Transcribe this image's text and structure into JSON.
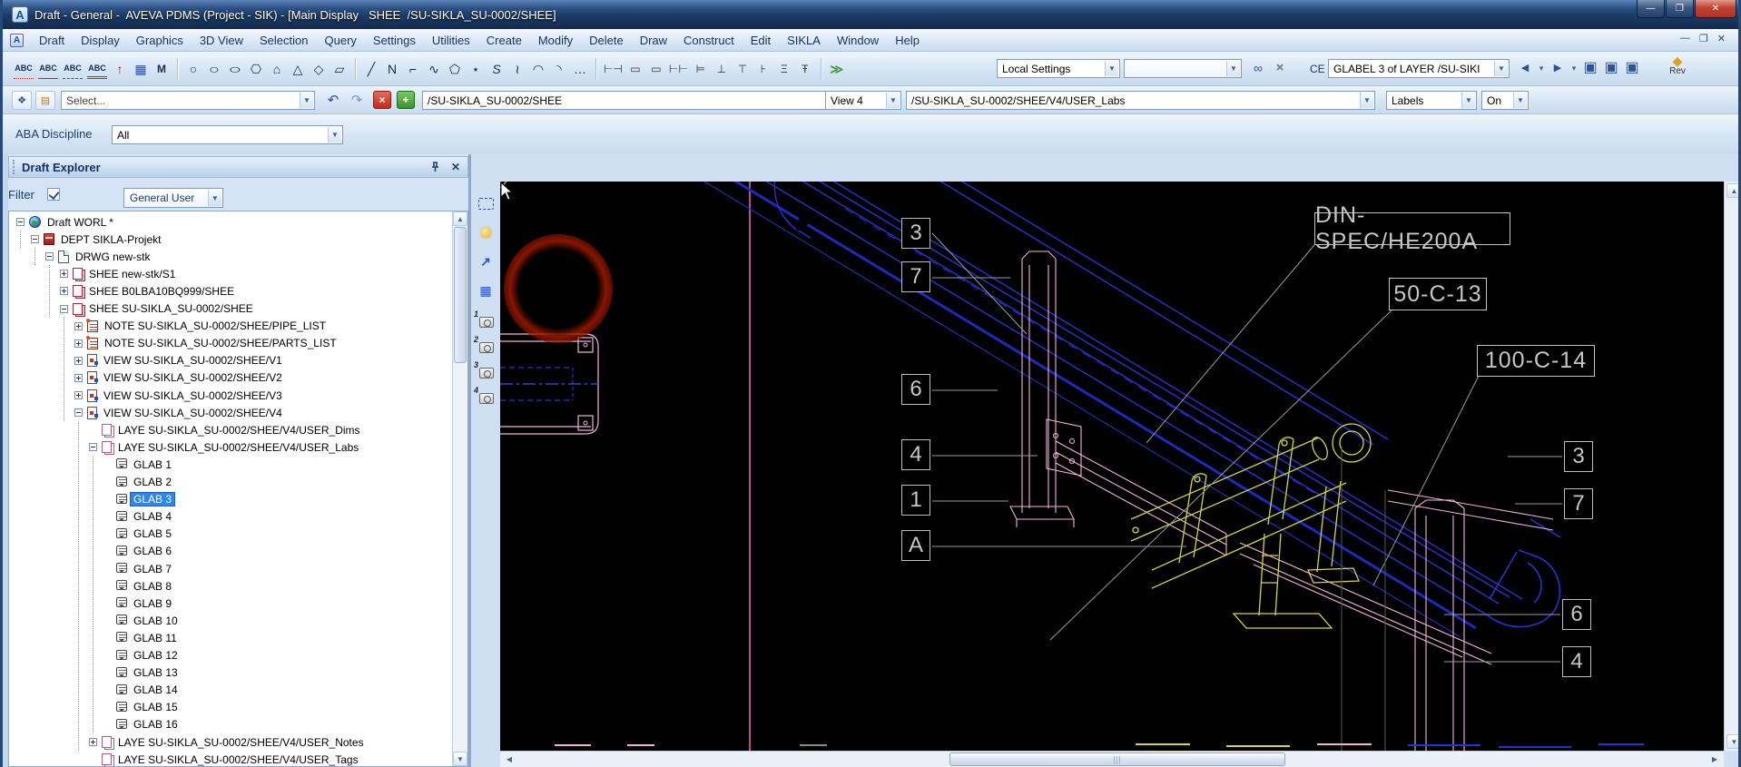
{
  "window": {
    "title": "Draft - General -  AVEVA PDMS (Project - SIK) - [Main Display   SHEE  /SU-SIKLA_SU-0002/SHEE]",
    "app_icon": "A",
    "controls": {
      "minimize": "—",
      "maximize": "❐",
      "close": "✕"
    }
  },
  "menu": {
    "items": [
      "Draft",
      "Display",
      "Graphics",
      "3D View",
      "Selection",
      "Query",
      "Settings",
      "Utilities",
      "Create",
      "Modify",
      "Delete",
      "Draw",
      "Construct",
      "Edit",
      "SIKLA",
      "Window",
      "Help"
    ],
    "mdi_controls": [
      "—",
      "❐",
      "✕"
    ]
  },
  "toolbar_draw": {
    "icons": [
      "abc-dotted-icon",
      "abc-solid-icon",
      "abc-dashed-icon",
      "abc-double-icon",
      "text-up-arrow-icon",
      "hatch-grid-icon",
      "text-orient-icon",
      "|",
      "circle-icon",
      "ellipse-icon",
      "oval-icon",
      "hexagon-icon",
      "pentagon-icon",
      "triangle-icon",
      "diamond-icon",
      "parallelogram-icon",
      "|",
      "line-icon",
      "polyline-icon",
      "step-line-icon",
      "sketch-line-icon",
      "polygon-icon",
      "star-icon",
      "s-curve-icon",
      "wave-icon",
      "arc-icon",
      "fillet-icon",
      "ellipsis-icon",
      "|",
      "h-dim-icon",
      "box-dim-icon",
      "frame-dim-icon",
      "chain-dim-icon",
      "ladder-dim-icon",
      "v-dim-1-icon",
      "v-dim-2-icon",
      "v-dim-3-icon",
      "v-dim-4-icon",
      "v-dim-5-icon",
      "|",
      "fast-forward-icon"
    ],
    "right_icons": [
      "find-icon",
      "delete-x-icon"
    ],
    "nav_icons": [
      "nav-back-icon",
      "nav-back-drop-icon",
      "nav-fwd-icon",
      "nav-fwd-drop-icon",
      "window-new-icon",
      "window-cascade-icon",
      "window-tile-icon"
    ],
    "local_settings_combo": "Local Settings",
    "empty_combo": "",
    "ce_label": "CE",
    "glabel_combo": "GLABEL 3 of LAYER /SU-SIKI",
    "rev_label": "Rev"
  },
  "toolbar_nav": {
    "left_icons": [
      "sheet-new-icon",
      "card-icon"
    ],
    "select_combo": "Select...",
    "undo_icon": "↶",
    "redo_icon": "↷",
    "delete_button": "×",
    "add_button": "+",
    "sheet_combo": "/SU-SIKLA_SU-0002/SHEE",
    "view_combo": "View 4",
    "layer_combo": "/SU-SIKLA_SU-0002/SHEE/V4/USER_Labs",
    "labels_combo": "Labels",
    "on_combo": "On"
  },
  "discipline": {
    "label": "ABA Discipline",
    "value": "All"
  },
  "explorer": {
    "title": "Draft Explorer",
    "filter_label": "Filter",
    "filter_checked": true,
    "filter_value": "General User",
    "tree": [
      {
        "label": "Draft WORL *",
        "level": 0,
        "expander": "minus",
        "icon": "globe"
      },
      {
        "label": "DEPT SIKLA-Projekt",
        "level": 1,
        "expander": "minus",
        "icon": "dept"
      },
      {
        "label": "DRWG new-stk",
        "level": 2,
        "expander": "minus",
        "icon": "drwg"
      },
      {
        "label": "SHEE new-stk/S1",
        "level": 3,
        "expander": "plus",
        "icon": "shee"
      },
      {
        "label": "SHEE B0LBA10BQ999/SHEE",
        "level": 3,
        "expander": "plus",
        "icon": "shee"
      },
      {
        "label": "SHEE SU-SIKLA_SU-0002/SHEE",
        "level": 3,
        "expander": "minus",
        "icon": "shee"
      },
      {
        "label": "NOTE SU-SIKLA_SU-0002/SHEE/PIPE_LIST",
        "level": 4,
        "expander": "plus",
        "icon": "note"
      },
      {
        "label": "NOTE SU-SIKLA_SU-0002/SHEE/PARTS_LIST",
        "level": 4,
        "expander": "plus",
        "icon": "note"
      },
      {
        "label": "VIEW SU-SIKLA_SU-0002/SHEE/V1",
        "level": 4,
        "expander": "plus",
        "icon": "view"
      },
      {
        "label": "VIEW SU-SIKLA_SU-0002/SHEE/V2",
        "level": 4,
        "expander": "plus",
        "icon": "view"
      },
      {
        "label": "VIEW SU-SIKLA_SU-0002/SHEE/V3",
        "level": 4,
        "expander": "plus",
        "icon": "view"
      },
      {
        "label": "VIEW SU-SIKLA_SU-0002/SHEE/V4",
        "level": 4,
        "expander": "minus",
        "icon": "view"
      },
      {
        "label": "LAYE SU-SIKLA_SU-0002/SHEE/V4/USER_Dims",
        "level": 5,
        "expander": "none",
        "icon": "laye"
      },
      {
        "label": "LAYE SU-SIKLA_SU-0002/SHEE/V4/USER_Labs",
        "level": 5,
        "expander": "minus",
        "icon": "laye"
      },
      {
        "label": "GLAB 1",
        "level": 6,
        "expander": "none",
        "icon": "glab"
      },
      {
        "label": "GLAB 2",
        "level": 6,
        "expander": "none",
        "icon": "glab"
      },
      {
        "label": "GLAB 3",
        "level": 6,
        "expander": "none",
        "icon": "glab",
        "selected": true
      },
      {
        "label": "GLAB 4",
        "level": 6,
        "expander": "none",
        "icon": "glab"
      },
      {
        "label": "GLAB 5",
        "level": 6,
        "expander": "none",
        "icon": "glab"
      },
      {
        "label": "GLAB 6",
        "level": 6,
        "expander": "none",
        "icon": "glab"
      },
      {
        "label": "GLAB 7",
        "level": 6,
        "expander": "none",
        "icon": "glab"
      },
      {
        "label": "GLAB 8",
        "level": 6,
        "expander": "none",
        "icon": "glab"
      },
      {
        "label": "GLAB 9",
        "level": 6,
        "expander": "none",
        "icon": "glab"
      },
      {
        "label": "GLAB 10",
        "level": 6,
        "expander": "none",
        "icon": "glab"
      },
      {
        "label": "GLAB 11",
        "level": 6,
        "expander": "none",
        "icon": "glab"
      },
      {
        "label": "GLAB 12",
        "level": 6,
        "expander": "none",
        "icon": "glab"
      },
      {
        "label": "GLAB 13",
        "level": 6,
        "expander": "none",
        "icon": "glab"
      },
      {
        "label": "GLAB 14",
        "level": 6,
        "expander": "none",
        "icon": "glab"
      },
      {
        "label": "GLAB 15",
        "level": 6,
        "expander": "none",
        "icon": "glab"
      },
      {
        "label": "GLAB 16",
        "level": 6,
        "expander": "none",
        "icon": "glab"
      },
      {
        "label": "LAYE SU-SIKLA_SU-0002/SHEE/V4/USER_Notes",
        "level": 5,
        "expander": "plus",
        "icon": "laye"
      },
      {
        "label": "LAYE SU-SIKLA_SU-0002/SHEE/V4/USER_Tags",
        "level": 5,
        "expander": "none",
        "icon": "laye"
      }
    ]
  },
  "canvas_strip": {
    "icons": [
      "select-view-icon",
      "shade-icon",
      "pointer-arrow-icon",
      "grid-icon"
    ],
    "camera_labels": [
      "1",
      "2",
      "3",
      "4"
    ]
  },
  "canvas": {
    "callouts_left": [
      "3",
      "7",
      "6",
      "4",
      "1",
      "A"
    ],
    "callouts_right": [
      "3",
      "7",
      "6",
      "4"
    ],
    "labels": [
      "DIN-SPEC/HE200A",
      "50-C-13",
      "100-C-14"
    ],
    "colors": {
      "beam": "#2433d6",
      "steel": "#f2b4d6",
      "pipe": "#d6d63a",
      "sheet_line": "#e86ac8",
      "callout": "#c6c6c6"
    }
  }
}
